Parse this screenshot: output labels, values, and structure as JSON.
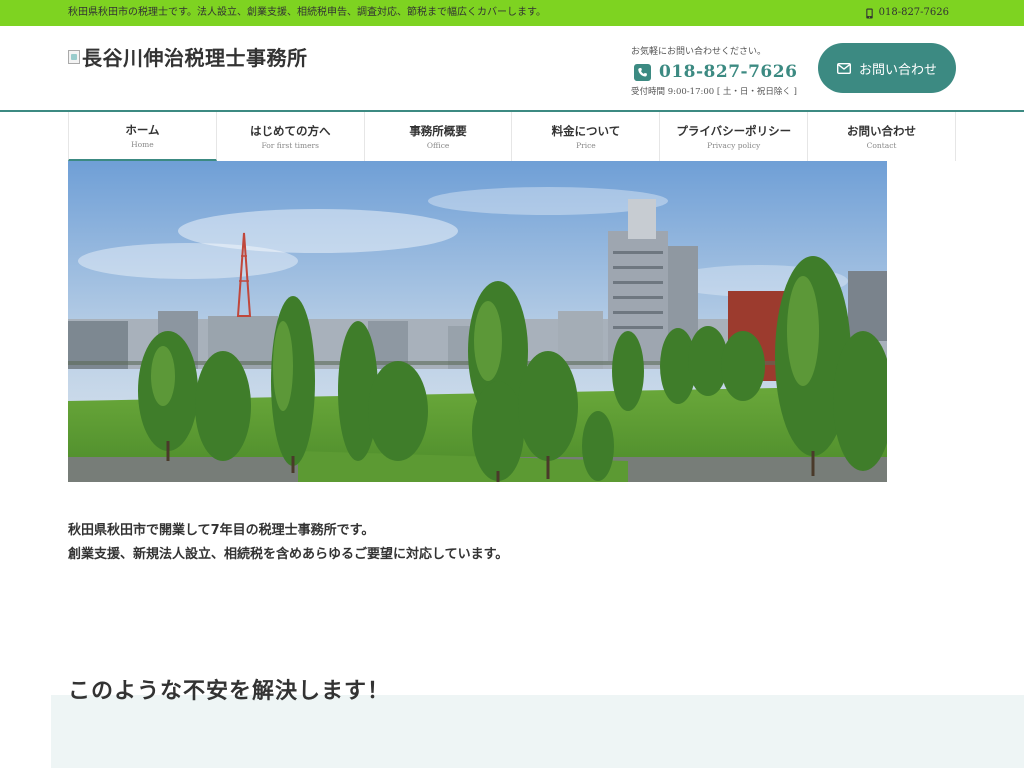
{
  "topbar": {
    "tagline": "秋田県秋田市の税理士です。法人設立、創業支援、相続税申告、調査対応、節税まで幅広くカバーします。",
    "phone": "018-827-7626"
  },
  "header": {
    "logo_text": "長谷川伸治税理士事務所",
    "contact_hint": "お気軽にお問い合わせください。",
    "tel": "018-827-7626",
    "hours": "受付時間 9:00-17:00 [ 土・日・祝日除く ]",
    "contact_button": "お問い合わせ"
  },
  "nav": {
    "items": [
      {
        "jp": "ホーム",
        "en": "Home"
      },
      {
        "jp": "はじめての方へ",
        "en": "For first timers"
      },
      {
        "jp": "事務所概要",
        "en": "Office"
      },
      {
        "jp": "料金について",
        "en": "Price"
      },
      {
        "jp": "プライバシーポリシー",
        "en": "Privacy policy"
      },
      {
        "jp": "お問い合わせ",
        "en": "Contact"
      }
    ]
  },
  "main": {
    "intro_line1": "秋田県秋田市で開業して7年目の税理士事務所です。",
    "intro_line2": "創業支援、新規法人設立、相続税を含めあらゆるご要望に対応しています。",
    "section_title": "このような不安を解決します！"
  },
  "colors": {
    "topbar_green": "#7ed321",
    "accent_teal": "#3c8a82",
    "band_bg": "#eef5f5"
  }
}
